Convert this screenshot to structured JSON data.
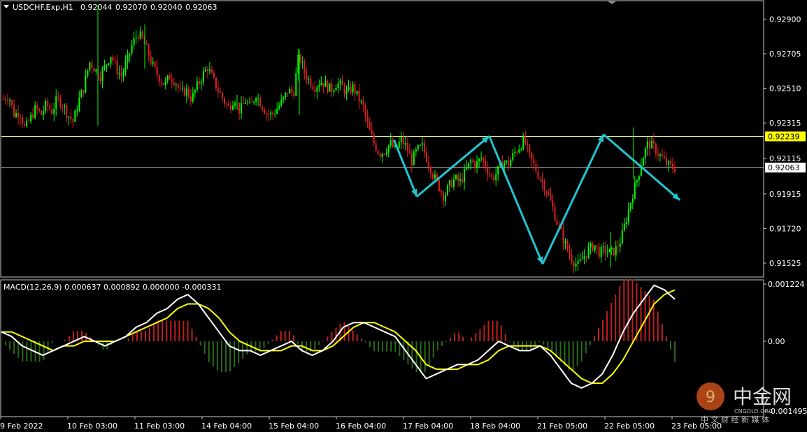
{
  "chart_data": {
    "type": "candlestick",
    "symbol_header": {
      "symbol": "USDCHF.Exp,H1",
      "ohlc": [
        "0.92044",
        "0.92070",
        "0.92040",
        "0.92063"
      ]
    },
    "price_axis": {
      "ylim": [
        0.9145,
        0.93
      ],
      "ticks": [
        "0.92900",
        "0.92705",
        "0.92510",
        "0.92315",
        "0.92115",
        "0.91915",
        "0.91720",
        "0.91525"
      ]
    },
    "horizontal_lines": [
      {
        "value": 0.92239,
        "label": "0.92239",
        "color": "#e8e89a",
        "label_bg": "#ffff00",
        "label_fg": "#000000"
      },
      {
        "value": 0.92063,
        "label": "0.92063",
        "color": "#c8c8c8",
        "label_bg": "#ffffff",
        "label_fg": "#000000"
      }
    ],
    "x_ticks": [
      "9 Feb 2022",
      "10 Feb 03:00",
      "11 Feb 03:00",
      "14 Feb 04:00",
      "15 Feb 04:00",
      "16 Feb 04:00",
      "17 Feb 04:00",
      "18 Feb 04:00",
      "21 Feb 05:00",
      "22 Feb 05:00",
      "23 Feb 05:00"
    ],
    "close_path": [
      0.9245,
      0.9247,
      0.9236,
      0.9238,
      0.9228,
      0.9234,
      0.924,
      0.9236,
      0.9242,
      0.9238,
      0.9245,
      0.9242,
      0.9236,
      0.9232,
      0.9244,
      0.9252,
      0.9266,
      0.9262,
      0.9258,
      0.9264,
      0.927,
      0.9262,
      0.9258,
      0.9266,
      0.9276,
      0.9282,
      0.9278,
      0.927,
      0.9262,
      0.9257,
      0.9253,
      0.9258,
      0.9255,
      0.9248,
      0.925,
      0.9245,
      0.9252,
      0.9258,
      0.9263,
      0.9256,
      0.925,
      0.9244,
      0.924,
      0.9246,
      0.9238,
      0.9244,
      0.924,
      0.9248,
      0.9242,
      0.9237,
      0.9236,
      0.924,
      0.9244,
      0.925,
      0.9248,
      0.927,
      0.926,
      0.9255,
      0.9252,
      0.9255,
      0.9253,
      0.925,
      0.9254,
      0.9252,
      0.9248,
      0.9252,
      0.9246,
      0.924,
      0.9228,
      0.922,
      0.9214,
      0.9216,
      0.922,
      0.9216,
      0.9222,
      0.9218,
      0.921,
      0.9216,
      0.9218,
      0.921,
      0.9202,
      0.9196,
      0.919,
      0.9196,
      0.92,
      0.9198,
      0.9204,
      0.921,
      0.9208,
      0.9212,
      0.9206,
      0.92,
      0.9204,
      0.921,
      0.9208,
      0.9214,
      0.9218,
      0.9222,
      0.9212,
      0.9206,
      0.92,
      0.9194,
      0.9186,
      0.9176,
      0.9168,
      0.916,
      0.9154,
      0.9151,
      0.9156,
      0.916,
      0.9163,
      0.9158,
      0.916,
      0.9158,
      0.916,
      0.9166,
      0.9178,
      0.919,
      0.92,
      0.9212,
      0.922,
      0.9218,
      0.9214,
      0.921,
      0.9207,
      0.9206
    ],
    "trend_arrows": [
      {
        "points": [
          [
            0.515,
            0.9222
          ],
          [
            0.545,
            0.919
          ],
          [
            0.64,
            0.9224
          ],
          [
            0.71,
            0.9152
          ],
          [
            0.79,
            0.9225
          ],
          [
            0.89,
            0.9188
          ]
        ],
        "color": "#1fc6d2"
      }
    ],
    "macd": {
      "header": "MACD(12,26,9) 0.000637 0.000892 0.000000 -0.000331",
      "ticks": [
        "0.001224",
        "0.00",
        "-0.001495"
      ],
      "ylim": [
        -0.0016,
        0.0013
      ],
      "histogram_color_pos": "#c02020",
      "histogram_color_neg": "#2a6a1a",
      "line_main_color": "#ffffff",
      "line_signal_color": "#ffff00",
      "main": [
        0.0002,
        0.0001,
        -0.0001,
        -0.0002,
        -0.0003,
        -0.0002,
        -0.0001,
        0.0,
        0.0001,
        0.0,
        -0.0001,
        0.0,
        0.0001,
        0.0003,
        0.0004,
        0.0006,
        0.0007,
        0.0009,
        0.001,
        0.0008,
        0.0005,
        0.0002,
        -0.0001,
        -0.0002,
        -0.0002,
        -0.0003,
        -0.0002,
        -0.0001,
        0.0,
        -0.0002,
        -0.0003,
        -0.0002,
        0.0,
        0.0003,
        0.0004,
        0.0004,
        0.0003,
        0.0002,
        0.0001,
        -0.0002,
        -0.0005,
        -0.0008,
        -0.0007,
        -0.0006,
        -0.0005,
        -0.0005,
        -0.0004,
        -0.0002,
        0.0,
        -0.0001,
        -0.0002,
        -0.0002,
        -0.0001,
        -0.0003,
        -0.0006,
        -0.0009,
        -0.001,
        -0.0009,
        -0.0007,
        -0.0003,
        0.0002,
        0.0006,
        0.0009,
        0.0012,
        0.0011,
        0.0009
      ],
      "signal": [
        0.0002,
        0.0002,
        0.0001,
        0.0,
        -0.0001,
        -0.0002,
        -0.0001,
        -0.0001,
        0.0,
        0.0,
        0.0,
        0.0,
        0.0001,
        0.0002,
        0.0003,
        0.0004,
        0.0005,
        0.0007,
        0.0008,
        0.0008,
        0.0007,
        0.0005,
        0.0002,
        0.0,
        -0.0001,
        -0.0002,
        -0.0002,
        -0.0002,
        -0.0001,
        -0.0001,
        -0.0002,
        -0.0002,
        -0.0001,
        0.0001,
        0.0003,
        0.0004,
        0.0004,
        0.0003,
        0.0002,
        0.0,
        -0.0002,
        -0.0005,
        -0.0006,
        -0.0006,
        -0.0006,
        -0.0005,
        -0.0005,
        -0.0004,
        -0.0002,
        -0.0001,
        -0.0001,
        -0.0001,
        -0.0001,
        -0.0002,
        -0.0004,
        -0.0006,
        -0.0008,
        -0.0009,
        -0.0009,
        -0.0007,
        -0.0004,
        0.0,
        0.0004,
        0.0008,
        0.001,
        0.0011
      ]
    }
  },
  "watermark": {
    "brand": "中金网",
    "domain": "CNGOLD.ORG",
    "tagline": "中 文 财 经 新 媒 体"
  },
  "colors": {
    "bull": "#00ff00",
    "bear": "#e02020",
    "frame": "#c8c8c8",
    "arrow": "#1fc6d2"
  }
}
